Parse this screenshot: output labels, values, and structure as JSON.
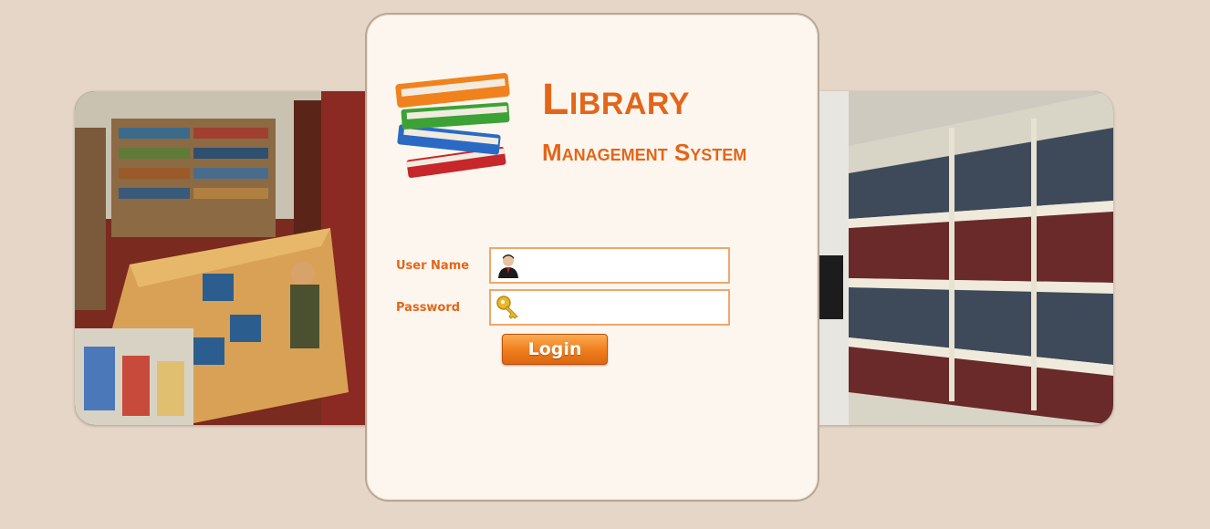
{
  "app": {
    "title": "Library",
    "subtitle": "Management System"
  },
  "form": {
    "username_label": "User Name",
    "username_value": "",
    "password_label": "Password",
    "password_value": "",
    "login_label": "Login"
  },
  "colors": {
    "accent": "#e2661a",
    "background": "#e6d6c8",
    "card": "#fdf6ee",
    "field_border": "#f0a66a"
  },
  "icons": {
    "username": "user-avatar-icon",
    "password": "key-icon",
    "logo": "books-stack-icon"
  }
}
